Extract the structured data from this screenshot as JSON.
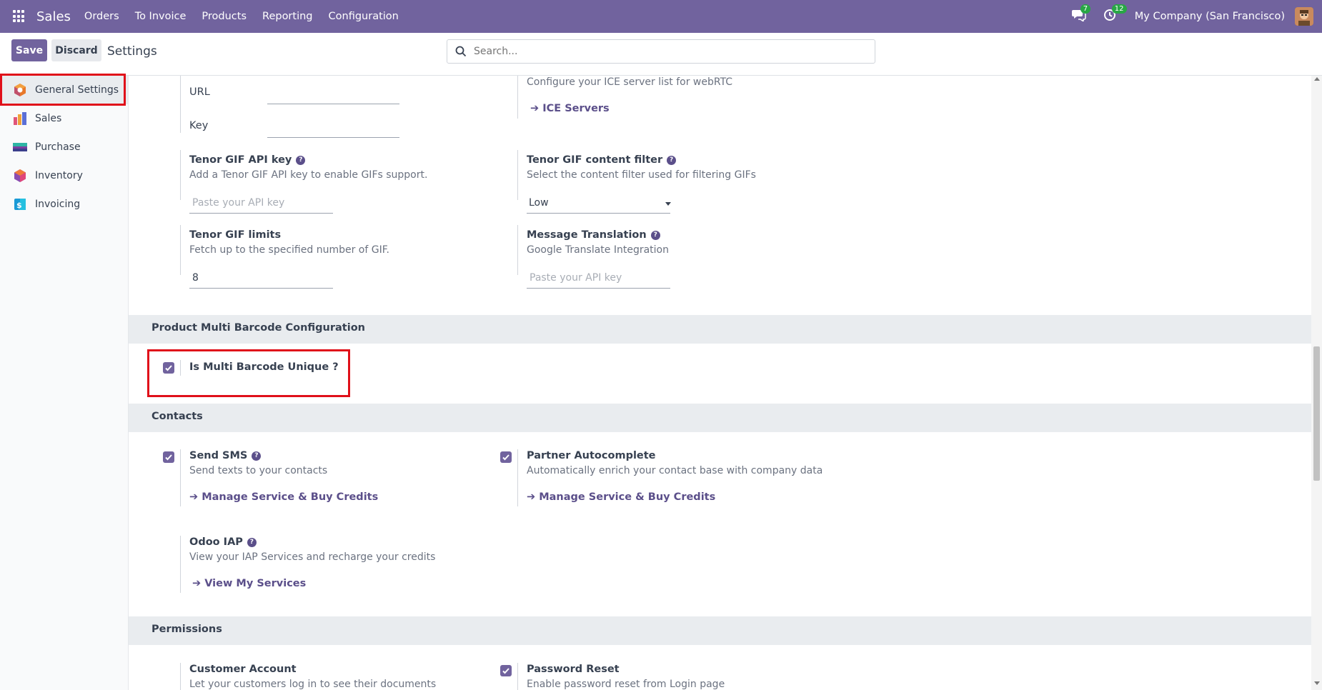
{
  "navbar": {
    "app_name": "Sales",
    "menu": [
      "Orders",
      "To Invoice",
      "Products",
      "Reporting",
      "Configuration"
    ],
    "messages_count": "7",
    "activities_count": "12",
    "company": "My Company (San Francisco)",
    "icons": {
      "apps": "apps-grid-icon",
      "messages": "chat-bubbles-icon",
      "activities": "clock-icon"
    }
  },
  "control_panel": {
    "save_label": "Save",
    "discard_label": "Discard",
    "title": "Settings",
    "search_placeholder": "Search..."
  },
  "sidebar": {
    "items": [
      {
        "label": "General Settings",
        "icon": "general-settings-icon",
        "active": true
      },
      {
        "label": "Sales",
        "icon": "sales-icon"
      },
      {
        "label": "Purchase",
        "icon": "purchase-icon"
      },
      {
        "label": "Inventory",
        "icon": "inventory-icon"
      },
      {
        "label": "Invoicing",
        "icon": "invoicing-icon"
      }
    ]
  },
  "settings": {
    "url_label": "URL",
    "key_label": "Key",
    "ice_desc": "Configure your ICE server list for webRTC",
    "ice_link": "ICE Servers",
    "tenor_key_title": "Tenor GIF API key",
    "tenor_key_desc": "Add a Tenor GIF API key to enable GIFs support.",
    "tenor_key_placeholder": "Paste your API key",
    "tenor_filter_title": "Tenor GIF content filter",
    "tenor_filter_desc": "Select the content filter used for filtering GIFs",
    "tenor_filter_value": "Low",
    "tenor_limits_title": "Tenor GIF limits",
    "tenor_limits_desc": "Fetch up to the specified number of GIF.",
    "tenor_limits_value": "8",
    "translation_title": "Message Translation",
    "translation_desc": "Google Translate Integration",
    "translation_placeholder": "Paste your API key"
  },
  "barcode_section": {
    "title": "Product Multi Barcode Configuration",
    "unique_label": "Is Multi Barcode Unique ?",
    "unique_checked": true
  },
  "contacts_section": {
    "title": "Contacts",
    "sms_title": "Send SMS",
    "sms_desc": "Send texts to your contacts",
    "sms_link": "Manage Service & Buy Credits",
    "autocomplete_title": "Partner Autocomplete",
    "autocomplete_desc": "Automatically enrich your contact base with company data",
    "autocomplete_link": "Manage Service & Buy Credits",
    "iap_title": "Odoo IAP",
    "iap_desc": "View your IAP Services and recharge your credits",
    "iap_link": "View My Services"
  },
  "permissions_section": {
    "title": "Permissions",
    "customer_account_title": "Customer Account",
    "customer_account_desc": "Let your customers log in to see their documents",
    "password_reset_title": "Password Reset",
    "password_reset_desc": "Enable password reset from Login page"
  },
  "colors": {
    "brand": "#71639e",
    "link": "#5b4f8a",
    "highlight": "#e0101a"
  }
}
